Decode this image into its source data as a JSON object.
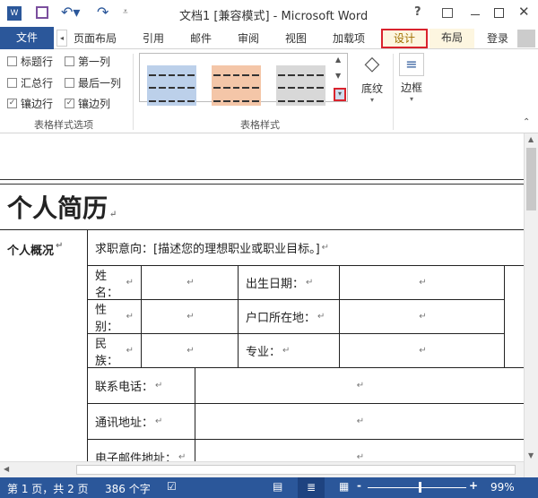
{
  "title": "文档1 [兼容模式] - Microsoft Word",
  "tabs": {
    "file": "文件",
    "items": [
      "页面布局",
      "引用",
      "邮件",
      "审阅",
      "视图",
      "加载项",
      "设计",
      "布局"
    ],
    "login": "登录",
    "active": "设计"
  },
  "ribbon": {
    "options": [
      {
        "label": "标题行",
        "checked": false
      },
      {
        "label": "第一列",
        "checked": false
      },
      {
        "label": "汇总行",
        "checked": false
      },
      {
        "label": "最后一列",
        "checked": false
      },
      {
        "label": "镶边行",
        "checked": true
      },
      {
        "label": "镶边列",
        "checked": true
      }
    ],
    "group_options": "表格样式选项",
    "group_styles": "表格样式",
    "shading": "底纹",
    "borders": "边框",
    "style_colors": [
      "#bcd0ea",
      "#f4c6a8",
      "#d8d8d8"
    ]
  },
  "document": {
    "heading": "个人简历",
    "section": "个人概况",
    "objective": "求职意向：[描述您的理想职业或职业目标。]",
    "labels": {
      "name": "姓名：",
      "birth": "出生日期：",
      "gender": "性别：",
      "hukou": "户口所在地：",
      "ethnic": "民族：",
      "major": "专业：",
      "phone": "联系电话：",
      "address": "通讯地址：",
      "email": "电子邮件地址："
    }
  },
  "status": {
    "page": "第 1 页，共 2 页",
    "words": "386 个字",
    "zoom": "99%",
    "accent": "#2b579a"
  }
}
